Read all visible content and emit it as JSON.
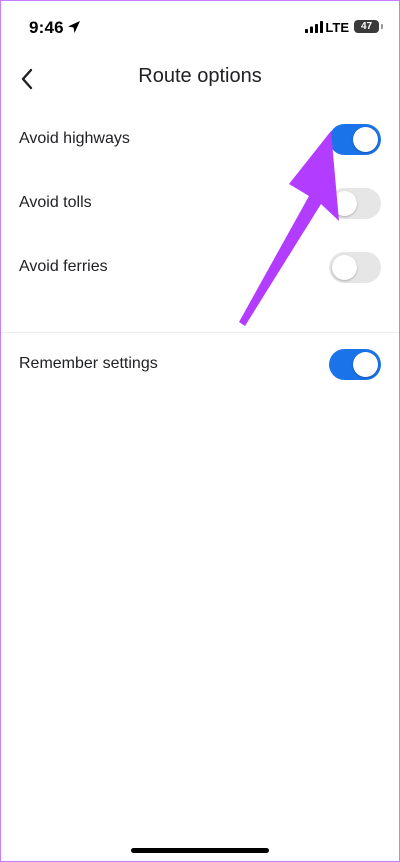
{
  "status_bar": {
    "time": "9:46",
    "network": "LTE",
    "battery": "47"
  },
  "header": {
    "title": "Route options"
  },
  "settings": [
    {
      "label": "Avoid highways",
      "enabled": true
    },
    {
      "label": "Avoid tolls",
      "enabled": false
    },
    {
      "label": "Avoid ferries",
      "enabled": false
    }
  ],
  "remember": {
    "label": "Remember settings",
    "enabled": true
  },
  "colors": {
    "toggle_on": "#1a73e8",
    "toggle_off": "#e6e6e6",
    "annotation_arrow": "#b23cff"
  },
  "icons": {
    "back": "chevron-left-icon",
    "location": "location-arrow-icon",
    "signal": "cellular-signal-icon",
    "annotation": "pointer-arrow-icon"
  }
}
